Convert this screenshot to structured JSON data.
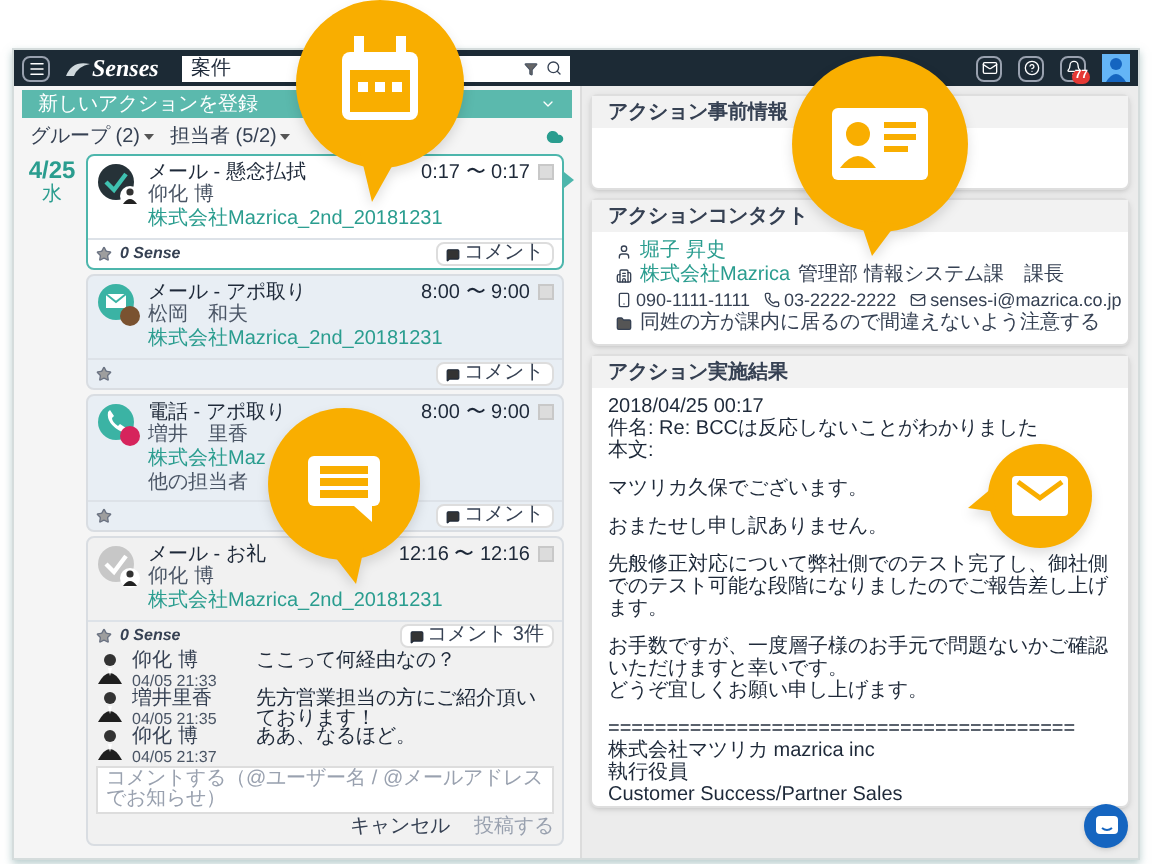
{
  "topbar": {
    "logo": "Senses",
    "search": {
      "value": "案件"
    },
    "notification_badge": "77"
  },
  "left": {
    "banner": "新しいアクションを登録",
    "filters": [
      {
        "label": "グループ (2)"
      },
      {
        "label": "担当者 (5/2)"
      }
    ],
    "date": {
      "day": "4/25",
      "weekday": "水"
    },
    "actions": [
      {
        "kind": "check",
        "title": "メール - 懸念払拭",
        "time": "0:17 〜 0:17",
        "person": "仰化 博",
        "company": "株式会社Mazrica_2nd_20181231",
        "selected": true,
        "expanded": false,
        "sense": "0 Sense",
        "comment": "コメント"
      },
      {
        "kind": "mail",
        "title": "メール - アポ取り",
        "time": "8:00 〜 9:00",
        "person": "松岡　和夫",
        "company": "株式会社Mazrica_2nd_20181231",
        "selected": false,
        "expanded": false,
        "comment": "コメント"
      },
      {
        "kind": "phone",
        "title": "電話 - アポ取り",
        "time": "8:00 〜 9:00",
        "person": "増井　里香",
        "company": "株式会社Maz",
        "others_label": "他の担当者",
        "selected": false,
        "expanded": false,
        "comment": "コメント"
      },
      {
        "kind": "check-muted",
        "title": "メール - お礼",
        "time": "12:16 〜 12:16",
        "person": "仰化 博",
        "company": "株式会社Mazrica_2nd_20181231",
        "selected": false,
        "expanded": true,
        "sense": "0 Sense",
        "comment": "コメント 3件",
        "comments": [
          {
            "name": "仰化 博",
            "date": "04/05 21:33",
            "text": "ここって何経由なの？"
          },
          {
            "name": "増井里香",
            "date": "04/05 21:35",
            "text": "先方営業担当の方にご紹介頂いております！"
          },
          {
            "name": "仰化 博",
            "date": "04/05 21:37",
            "text": "ああ、なるほど。"
          }
        ],
        "input": {
          "placeholder": "コメントする（@ユーザー名 / @メールアドレスでお知らせ）"
        },
        "buttons": [
          {
            "label": "キャンセル",
            "disabled": false
          },
          {
            "label": "投稿する",
            "disabled": true
          }
        ]
      }
    ]
  },
  "details": {
    "sections": [
      {
        "kind": "empty",
        "title": "アクション事前情報"
      },
      {
        "kind": "contact",
        "title": "アクションコンタクト",
        "name": "堀子 昇史",
        "company": "株式会社Mazrica",
        "department": "管理部 情報システム課　課長",
        "mobile": "090-1111-1111",
        "phone": "03-2222-2222",
        "email": "senses-i@mazrica.co.jp",
        "note": "同姓の方が課内に居るので間違えないよう注意する"
      },
      {
        "kind": "result",
        "title": "アクション実施結果",
        "paragraphs": [
          [
            "2018/04/25 00:17",
            "件名: Re: BCCは反応しないことがわかりました",
            "本文:"
          ],
          [
            "マツリカ久保でございます。"
          ],
          [
            "おまたせし申し訳ありません。"
          ],
          [
            "先般修正対応について弊社側でのテスト完了し、御社側でのテスト可能な段階になりましたのでご報告差し上げます。"
          ],
          [
            "お手数ですが、一度層子様のお手元で問題ないかご確認いただけますと幸いです。",
            "どうぞ宜しくお願い申し上げます。"
          ],
          [
            "========================================",
            "株式会社マツリカ mazrica inc",
            "執行役員",
            "Customer Success/Partner Sales"
          ]
        ]
      }
    ]
  }
}
